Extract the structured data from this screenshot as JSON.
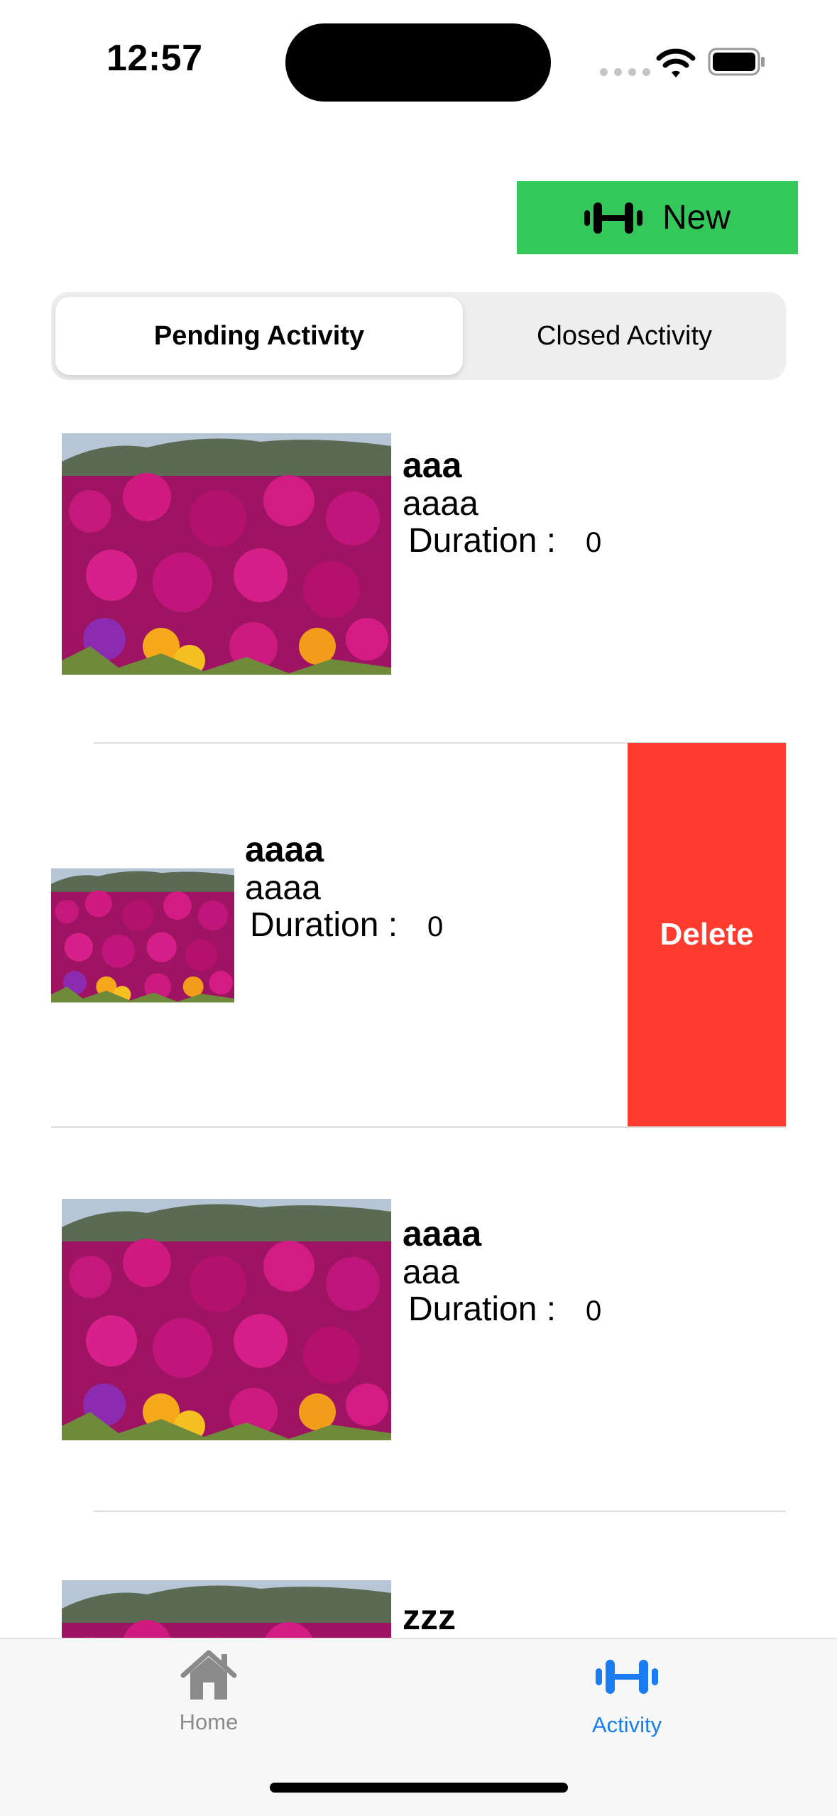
{
  "status_bar": {
    "time": "12:57"
  },
  "header": {
    "new_button_label": "New"
  },
  "segments": {
    "pending": "Pending Activity",
    "closed": "Closed Activity"
  },
  "activities": [
    {
      "title": "aaa",
      "subtitle": "aaaa",
      "duration_label": "Duration :",
      "duration_value": "0"
    },
    {
      "title": "aaaa",
      "subtitle": "aaaa",
      "duration_label": "Duration :",
      "duration_value": "0"
    },
    {
      "title": "aaaa",
      "subtitle": "aaa",
      "duration_label": "Duration :",
      "duration_value": "0"
    },
    {
      "title": "zzz"
    }
  ],
  "row_actions": {
    "delete_label": "Delete"
  },
  "tabs": {
    "home": "Home",
    "activity": "Activity"
  },
  "colors": {
    "new_button": "#34c759",
    "delete": "#ff3b30",
    "active_tab": "#1a7cf0",
    "inactive_tab": "#8a8a8a"
  }
}
